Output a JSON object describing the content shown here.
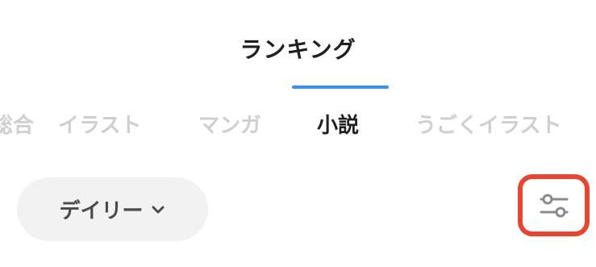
{
  "header": {
    "title": "ランキング"
  },
  "tabs": [
    {
      "label": "総合",
      "active": false
    },
    {
      "label": "イラスト",
      "active": false
    },
    {
      "label": "マンガ",
      "active": false
    },
    {
      "label": "小説",
      "active": true
    },
    {
      "label": "うごくイラスト",
      "active": false
    }
  ],
  "period": {
    "label": "デイリー",
    "icon": "chevron-down-icon"
  },
  "filter": {
    "icon": "sliders-icon"
  },
  "colors": {
    "accent": "#3d8ee8",
    "highlight": "#e64530",
    "active_text": "#1f1f1f",
    "inactive_text": "#cfcfcf",
    "pill_bg": "#f2f2f2"
  }
}
